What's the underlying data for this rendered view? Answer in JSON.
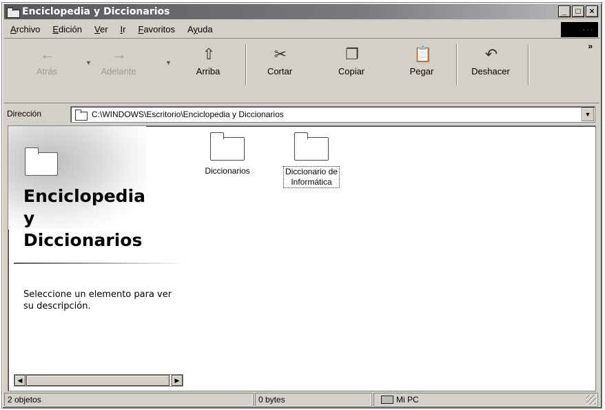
{
  "window": {
    "title": "Enciclopedia y Diccionarios",
    "controls": [
      "_",
      "□",
      "×"
    ]
  },
  "menu": [
    {
      "key": "A",
      "rest": "rchivo"
    },
    {
      "key": "E",
      "rest": "dición"
    },
    {
      "key": "V",
      "rest": "er"
    },
    {
      "key": "I",
      "rest": "r"
    },
    {
      "key": "F",
      "rest": "avoritos"
    },
    {
      "key": "y",
      "pre": "A",
      "rest": "uda"
    }
  ],
  "toolbar": {
    "back": {
      "label": "Atrás",
      "icon": "←",
      "enabled": false
    },
    "forward": {
      "label": "Adelante",
      "icon": "→",
      "enabled": false
    },
    "up": {
      "label": "Arriba",
      "icon": "⇧"
    },
    "cut": {
      "label": "Cortar",
      "icon": "✂"
    },
    "copy": {
      "label": "Copiar",
      "icon": "❐"
    },
    "paste": {
      "label": "Pegar",
      "icon": "📋"
    },
    "undo": {
      "label": "Deshacer",
      "icon": "↶"
    },
    "more": "»"
  },
  "address": {
    "label": "Dirección",
    "value": "C:\\WINDOWS\\Escritorio\\Enciclopedia y Diccionarios"
  },
  "webpanel": {
    "title_line1": "Enciclopedia",
    "title_line2": "y",
    "title_line3": "Diccionarios",
    "description": "Seleccione un elemento para ver su descripción."
  },
  "items": [
    {
      "label": "Diccionarios",
      "icon": "folder-icon",
      "selected": false
    },
    {
      "label_line1": "Diccionario de",
      "label_line2": "Informática",
      "icon": "folder-icon",
      "selected": true
    }
  ],
  "status": {
    "objects": "2 objetos",
    "size": "0 bytes",
    "zone": "Mi PC"
  }
}
